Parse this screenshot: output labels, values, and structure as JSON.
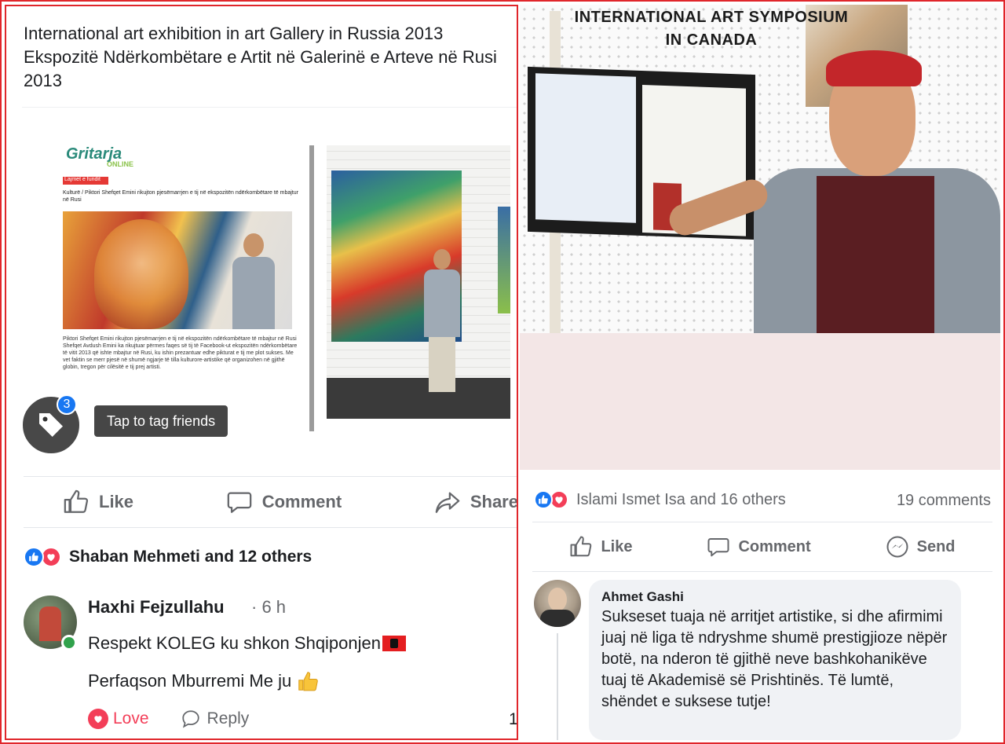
{
  "left_post": {
    "title": "International art exhibition in art Gallery in Russia 2013 Ekspozitë Ndërkombëtare e Artit në Galerinë e Arteve në Rusi 2013",
    "article": {
      "logo": "Gritarja",
      "logo_sub": "ONLINE",
      "section": "Lajmet e fundit",
      "breadcrumb": "Kulturë / Piktori Shefqet Emini rikujton pjesëmarrjen e tij në ekspozitën ndërkombëtare të mbajtur në Rusi",
      "body": "Piktori Shefqet Emini rikujton pjesëmarrjen e tij në ekspozitën ndërkombëtare të mbajtur në Rusi Shefqet Avdush Emini ka rikujtuar përmes faqes së tij të Facebook-ut ekspozitën ndërkombëtare të vitit 2013 që ishte mbajtur në Rusi, ku ishin prezantuar edhe pikturat e tij me plot sukses. Me vet faktin se merr pjesë në shumë ngjarje të tilla kulturore-artistike që organizohen në gjithë globin, tregon për cilësitë e tij prej artisti."
    },
    "tag": {
      "badge_count": "3",
      "tooltip": "Tap to tag friends"
    },
    "actions": {
      "like": "Like",
      "comment": "Comment",
      "share": "Share"
    },
    "reactions_text": "Shaban Mehmeti and 12 others",
    "comment": {
      "author": "Haxhi Fejzullahu",
      "time": "· 6 h",
      "line1": "Respekt KOLEG ku shkon Shqiponjen",
      "line2": "Perfaqson Mburremi Me ju",
      "love_label": "Love",
      "reply_label": "Reply",
      "count": "1"
    }
  },
  "right_post": {
    "hero_title": "INTERNATIONAL ART SYMPOSIUM IN CANADA",
    "reactions_text": "Islami Ismet Isa and 16 others",
    "comments_count": "19 comments",
    "actions": {
      "like": "Like",
      "comment": "Comment",
      "send": "Send"
    },
    "comment": {
      "author": "Ahmet Gashi",
      "body": "Sukseset tuaja në arritjet artistike, si dhe afirmimi juaj në liga të ndryshme shumë prestigjioze nëpër botë, na nderon të gjithë neve bashkohanikëve tuaj të Akademisë së Prishtinës. Të lumtë, shëndet e suksese tutje!"
    }
  },
  "colors": {
    "border_red": "#e0262b",
    "fb_blue": "#1877f2",
    "love_red": "#f33e58",
    "muted": "#65676b"
  }
}
